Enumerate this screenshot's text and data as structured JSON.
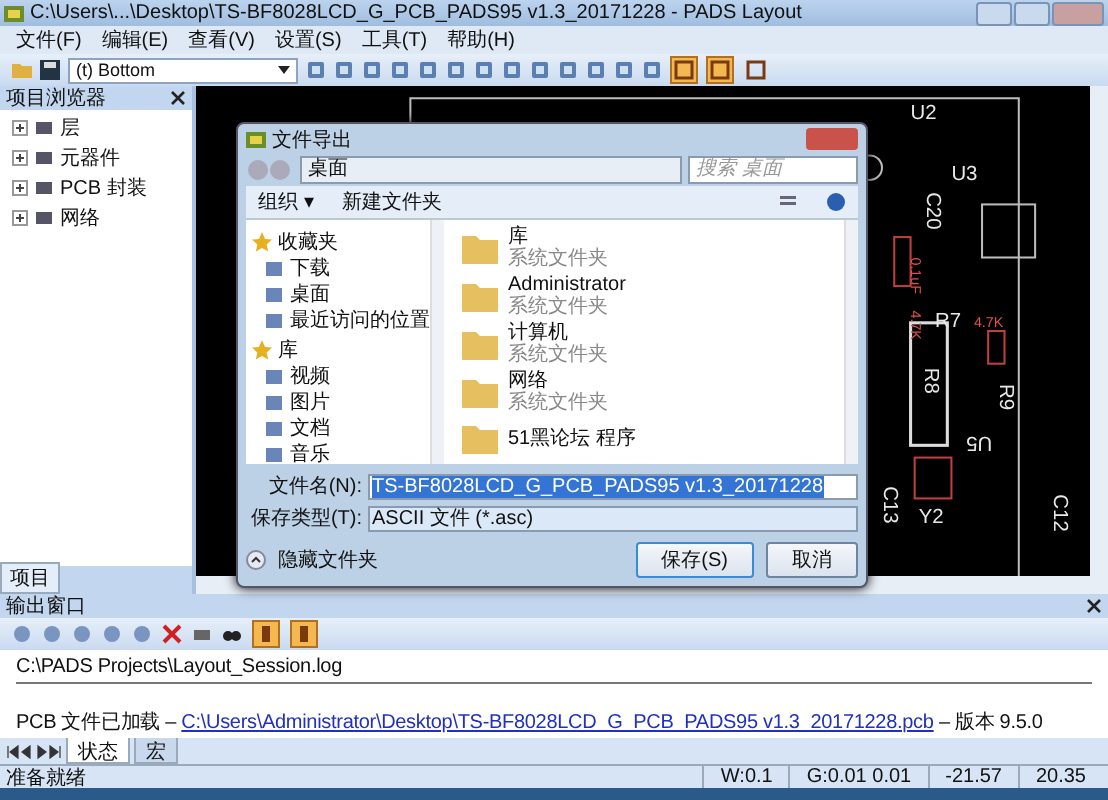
{
  "window": {
    "title": "C:\\Users\\...\\Desktop\\TS-BF8028LCD_G_PCB_PADS95 v1.3_20171228 - PADS Layout"
  },
  "menu": [
    "文件(F)",
    "编辑(E)",
    "查看(V)",
    "设置(S)",
    "工具(T)",
    "帮助(H)"
  ],
  "toolbar": {
    "layer": "(t) Bottom",
    "toggles": [
      {
        "selected": true
      },
      {
        "selected": true
      },
      {
        "selected": false
      }
    ]
  },
  "project_browser": {
    "title": "项目浏览器",
    "items": [
      {
        "label": "层",
        "expanded": false
      },
      {
        "label": "元器件",
        "expanded": false
      },
      {
        "label": "PCB 封装",
        "expanded": false
      },
      {
        "label": "网络",
        "expanded": false
      }
    ],
    "tab": "项目"
  },
  "pcb": {
    "labels": [
      "U2",
      "U3",
      "C20",
      "0.1uF",
      "4.7K",
      "R8",
      "R7",
      "4.7K",
      "R9",
      "U5",
      "C13",
      "Y2",
      "C12"
    ]
  },
  "dialog": {
    "title": "文件导出",
    "address": "桌面",
    "search": {
      "placeholder": "搜索 桌面"
    },
    "toolbar": [
      "组织 ▾",
      "新建文件夹"
    ],
    "nav": [
      {
        "kind": "group",
        "label": "收藏夹"
      },
      {
        "kind": "item",
        "label": "下载"
      },
      {
        "kind": "item",
        "label": "桌面"
      },
      {
        "kind": "item",
        "label": "最近访问的位置"
      },
      {
        "kind": "group",
        "label": "库"
      },
      {
        "kind": "item",
        "label": "视频"
      },
      {
        "kind": "item",
        "label": "图片"
      },
      {
        "kind": "item",
        "label": "文档"
      },
      {
        "kind": "item",
        "label": "音乐"
      }
    ],
    "files": [
      {
        "name": "库",
        "type": "系统文件夹"
      },
      {
        "name": "Administrator",
        "type": "系统文件夹"
      },
      {
        "name": "计算机",
        "type": "系统文件夹"
      },
      {
        "name": "网络",
        "type": "系统文件夹"
      },
      {
        "name": "51黑论坛 程序"
      }
    ],
    "filename_label": "文件名(N):",
    "filename": "TS-BF8028LCD_G_PCB_PADS95 v1.3_20171228",
    "type_label": "保存类型(T):",
    "type": "ASCII 文件 (*.asc)",
    "hide_folders": "隐藏文件夹",
    "buttons": [
      "保存(S)",
      "取消"
    ]
  },
  "output": {
    "title": "输出窗口",
    "toggles": [
      {
        "selected": true
      },
      {
        "selected": true
      }
    ],
    "log_path": "C:\\PADS Projects\\Layout_Session.log",
    "message": {
      "prefix": "PCB 文件已加载  –",
      "link": "C:\\Users\\Administrator\\Desktop\\TS-BF8028LCD_G_PCB_PADS95 v1.3_20171228.pcb",
      "suffix": "– 版本  9.5.0"
    },
    "tabs": [
      {
        "label": "状态",
        "selected": true
      },
      {
        "label": "宏",
        "selected": false
      }
    ]
  },
  "status_bar": {
    "message": "准备就绪",
    "fields": [
      "W:0.1",
      "G:0.01 0.01",
      "-21.57",
      "20.35"
    ]
  }
}
